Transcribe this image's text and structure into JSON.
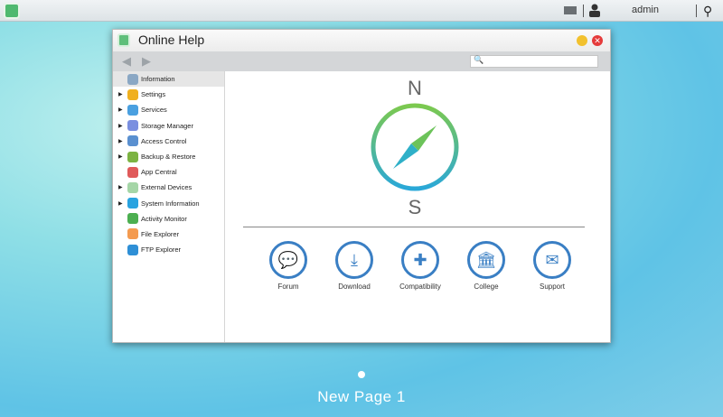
{
  "topbar": {
    "user": "admin"
  },
  "window": {
    "title": "Online Help",
    "search_placeholder": ""
  },
  "sidebar": {
    "items": [
      {
        "label": "Information",
        "expandable": false,
        "selected": true,
        "color": "#8aa7c4"
      },
      {
        "label": "Settings",
        "expandable": true,
        "color": "#f0b020"
      },
      {
        "label": "Services",
        "expandable": true,
        "color": "#4aa0e0"
      },
      {
        "label": "Storage Manager",
        "expandable": true,
        "color": "#7a8fe0"
      },
      {
        "label": "Access Control",
        "expandable": true,
        "color": "#5a90d0"
      },
      {
        "label": "Backup & Restore",
        "expandable": true,
        "color": "#7cb342"
      },
      {
        "label": "App Central",
        "expandable": false,
        "color": "#e05a5a"
      },
      {
        "label": "External Devices",
        "expandable": true,
        "color": "#a5d6a7"
      },
      {
        "label": "System Information",
        "expandable": true,
        "color": "#29a3e0"
      },
      {
        "label": "Activity Monitor",
        "expandable": false,
        "color": "#4caf50"
      },
      {
        "label": "File Explorer",
        "expandable": false,
        "color": "#f49b50"
      },
      {
        "label": "FTP Explorer",
        "expandable": false,
        "color": "#2e8fd6"
      }
    ]
  },
  "compass": {
    "north": "N",
    "south": "S"
  },
  "help_links": [
    {
      "label": "Forum",
      "icon": "chat-icon",
      "glyph": "💬"
    },
    {
      "label": "Download",
      "icon": "download-icon",
      "glyph": "⤓"
    },
    {
      "label": "Compatibility",
      "icon": "puzzle-icon",
      "glyph": "✚"
    },
    {
      "label": "College",
      "icon": "bank-icon",
      "glyph": "🏛"
    },
    {
      "label": "Support",
      "icon": "mail-icon",
      "glyph": "✉"
    }
  ],
  "desktop": {
    "page_label": "New Page 1"
  }
}
